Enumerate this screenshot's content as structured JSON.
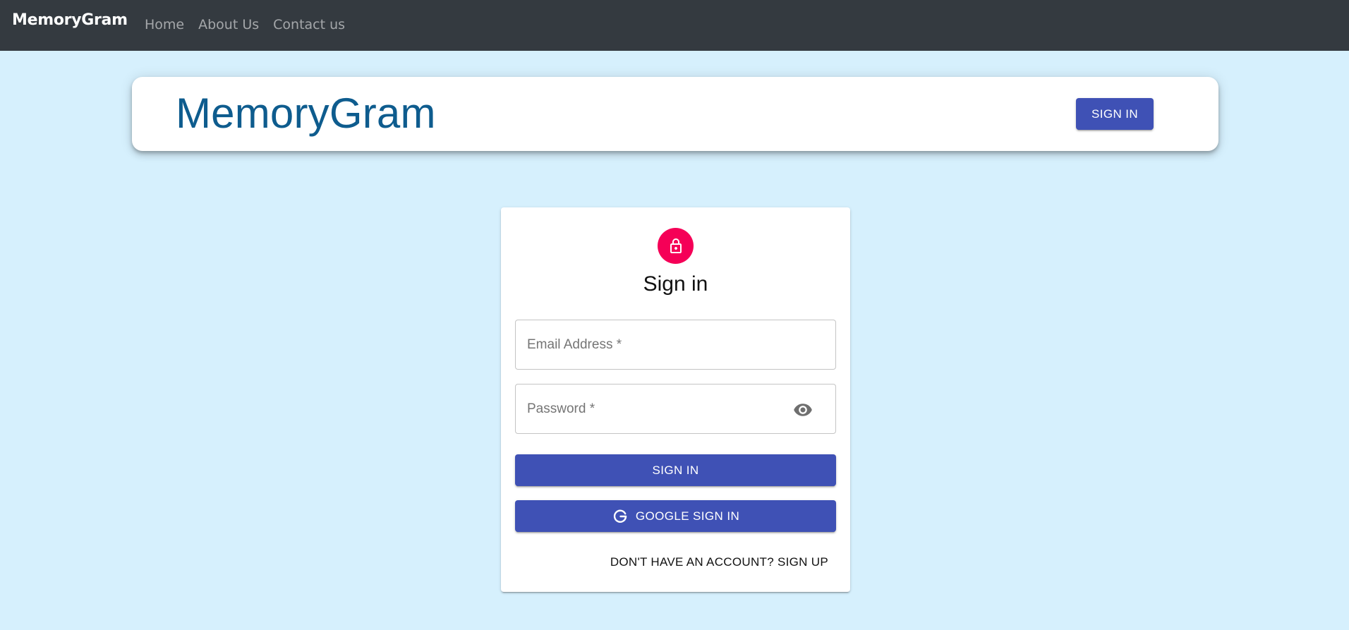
{
  "navbar": {
    "brand": "MemoryGram",
    "links": [
      {
        "label": "Home"
      },
      {
        "label": "About Us"
      },
      {
        "label": "Contact us"
      }
    ]
  },
  "header": {
    "title": "MemoryGram",
    "signin_label": "SIGN IN"
  },
  "signin_form": {
    "avatar_icon": "lock-icon",
    "title": "Sign in",
    "email": {
      "placeholder": "Email Address *",
      "value": ""
    },
    "password": {
      "placeholder": "Password *",
      "value": "",
      "toggle_icon": "eye-icon"
    },
    "submit_label": "SIGN IN",
    "google_label": "GOOGLE SIGN IN",
    "google_icon": "google-g-icon",
    "signup_link": "DON'T HAVE AN ACCOUNT? SIGN UP"
  },
  "colors": {
    "navbar_bg": "#343a40",
    "page_bg": "#d6f0fd",
    "title_blue": "#0e5c8e",
    "primary": "#3f51b5",
    "avatar_pink": "#f50057"
  }
}
